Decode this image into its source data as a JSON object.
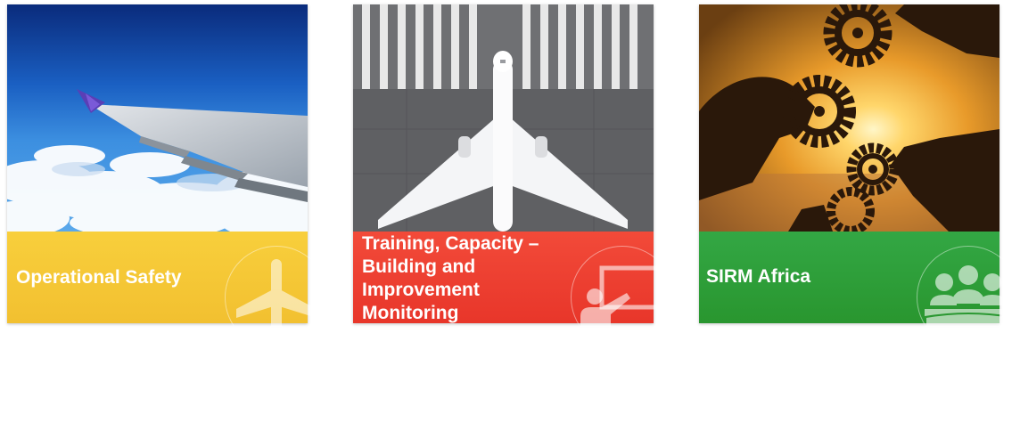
{
  "cards": [
    {
      "title": "Operational Safety",
      "icon": "airplane-icon",
      "color": "#f5c533"
    },
    {
      "title": "Training, Capacity – Building and Improvement Monitoring",
      "icon": "presentation-icon",
      "color": "#ee3f30"
    },
    {
      "title": "SIRM Africa",
      "icon": "group-icon",
      "color": "#2f9e3a"
    }
  ]
}
